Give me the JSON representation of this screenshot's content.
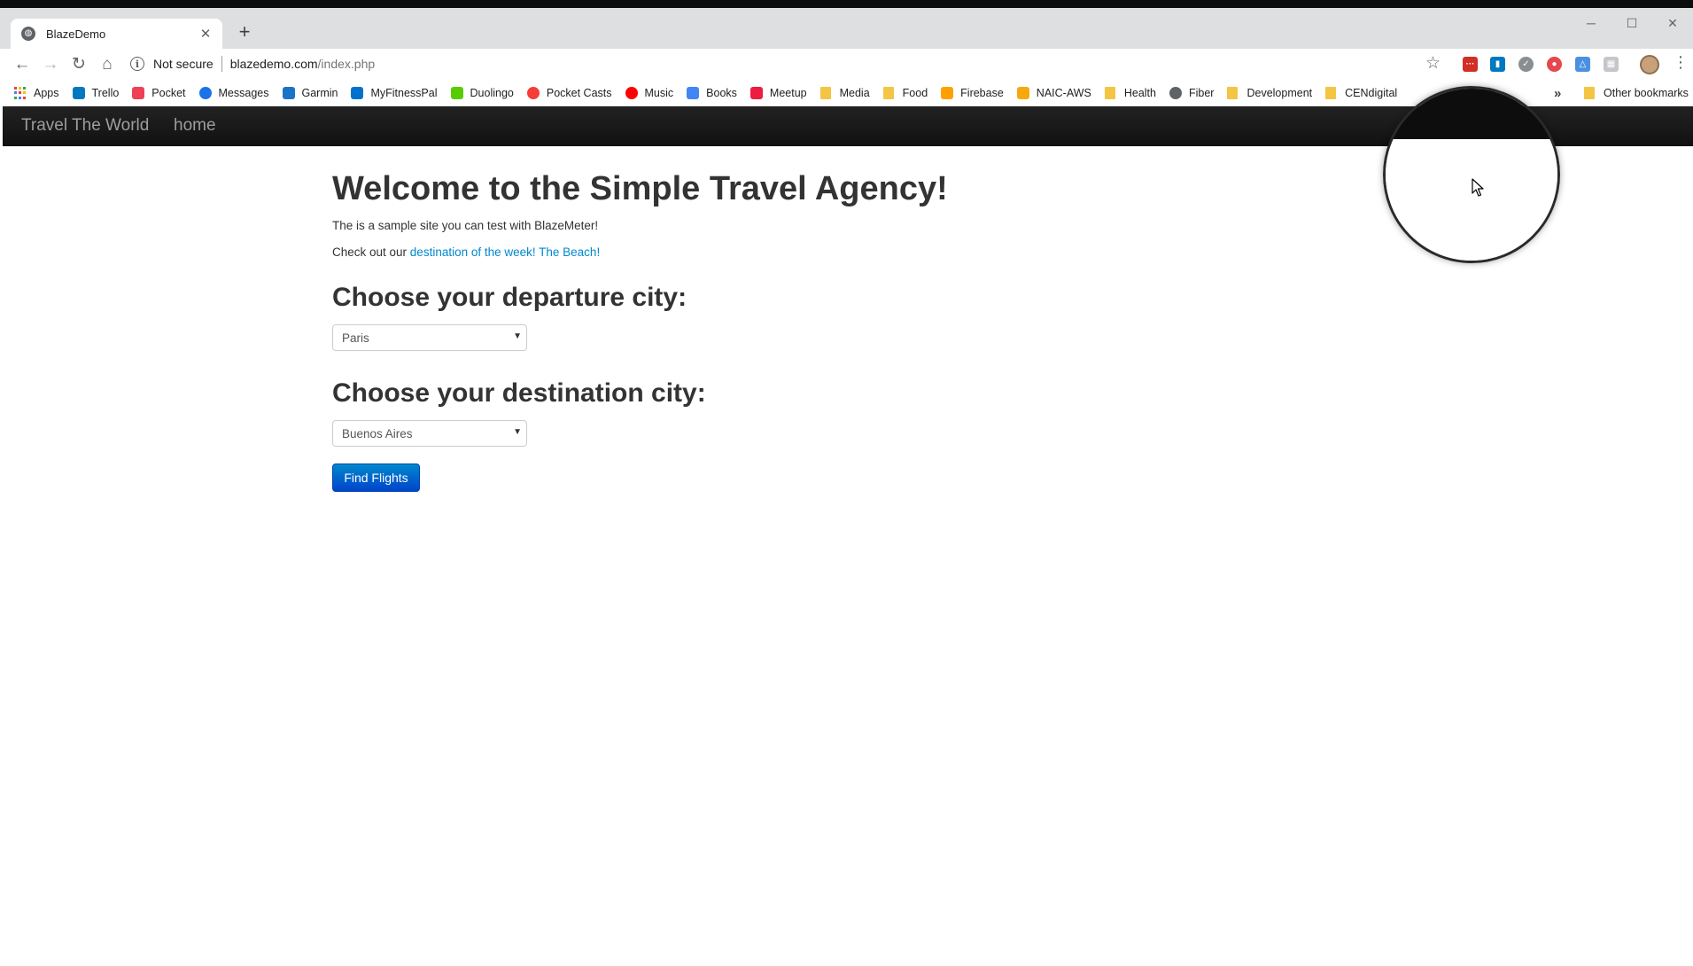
{
  "browser": {
    "tab": {
      "title": "BlazeDemo",
      "close_glyph": "✕",
      "icon": "globe-icon"
    },
    "new_tab_glyph": "+",
    "window_controls": [
      "─",
      "☐",
      "✕"
    ],
    "nav": {
      "back_glyph": "←",
      "forward_glyph": "→",
      "reload_glyph": "↻",
      "home_glyph": "⌂"
    },
    "omnibox": {
      "security_label": "Not secure",
      "url_host": "blazedemo.com",
      "url_path": "/index.php"
    },
    "star_glyph": "☆",
    "menu_glyph": "⋮",
    "extensions": [
      {
        "icon": "lastpass-icon",
        "color": "#d32d27",
        "glyph": "···"
      },
      {
        "icon": "trello-icon",
        "color": "#0079bf",
        "glyph": "▮"
      },
      {
        "icon": "grammarly-icon",
        "color": "#8a8d91",
        "glyph": "✓"
      },
      {
        "icon": "adblock-icon",
        "color": "#e4474d",
        "glyph": "●"
      },
      {
        "icon": "drive-icon",
        "color": "#4a90e2",
        "glyph": "△"
      },
      {
        "icon": "extension-icon",
        "color": "#c4c6c9",
        "glyph": "▦"
      }
    ]
  },
  "bookmarks": {
    "items": [
      {
        "label": "Apps",
        "icon": "apps-grid-icon",
        "color": "#4285f4"
      },
      {
        "label": "Trello",
        "icon": "trello-icon",
        "color": "#0079bf"
      },
      {
        "label": "Pocket",
        "icon": "pocket-icon",
        "color": "#ef4056"
      },
      {
        "label": "Messages",
        "icon": "messages-icon",
        "color": "#1a73e8"
      },
      {
        "label": "Garmin",
        "icon": "garmin-icon",
        "color": "#1a73c7"
      },
      {
        "label": "MyFitnessPal",
        "icon": "myfitnesspal-icon",
        "color": "#0072ce"
      },
      {
        "label": "Duolingo",
        "icon": "duolingo-icon",
        "color": "#58cc02"
      },
      {
        "label": "Pocket Casts",
        "icon": "pocket-casts-icon",
        "color": "#f43e37"
      },
      {
        "label": "Music",
        "icon": "music-icon",
        "color": "#ff0000"
      },
      {
        "label": "Books",
        "icon": "books-icon",
        "color": "#4285f4"
      },
      {
        "label": "Meetup",
        "icon": "meetup-icon",
        "color": "#ed1c40"
      },
      {
        "label": "Media",
        "icon": "folder-icon",
        "color": "#f4c542"
      },
      {
        "label": "Food",
        "icon": "folder-icon",
        "color": "#f4c542"
      },
      {
        "label": "Firebase",
        "icon": "firebase-icon",
        "color": "#ffa000"
      },
      {
        "label": "NAIC-AWS",
        "icon": "aws-icon",
        "color": "#f7a80d"
      },
      {
        "label": "Health",
        "icon": "folder-icon",
        "color": "#f4c542"
      },
      {
        "label": "Fiber",
        "icon": "google-icon",
        "color": "#5f6368"
      },
      {
        "label": "Development",
        "icon": "folder-icon",
        "color": "#f4c542"
      },
      {
        "label": "CENdigital",
        "icon": "folder-icon",
        "color": "#f4c542"
      }
    ],
    "overflow_glyph": "»",
    "other_label": "Other bookmarks"
  },
  "site": {
    "brand": "Travel The World",
    "nav_home": "home",
    "heading": "Welcome to the Simple Travel Agency!",
    "intro": "The is a sample site you can test with BlazeMeter!",
    "check_prefix": "Check out our ",
    "destination_link": "destination of the week! The Beach!",
    "departure_heading": "Choose your departure city:",
    "departure_value": "Paris",
    "destination_heading": "Choose your destination city:",
    "destination_value": "Buenos Aires",
    "select_arrow": "▼",
    "find_button": "Find Flights"
  }
}
